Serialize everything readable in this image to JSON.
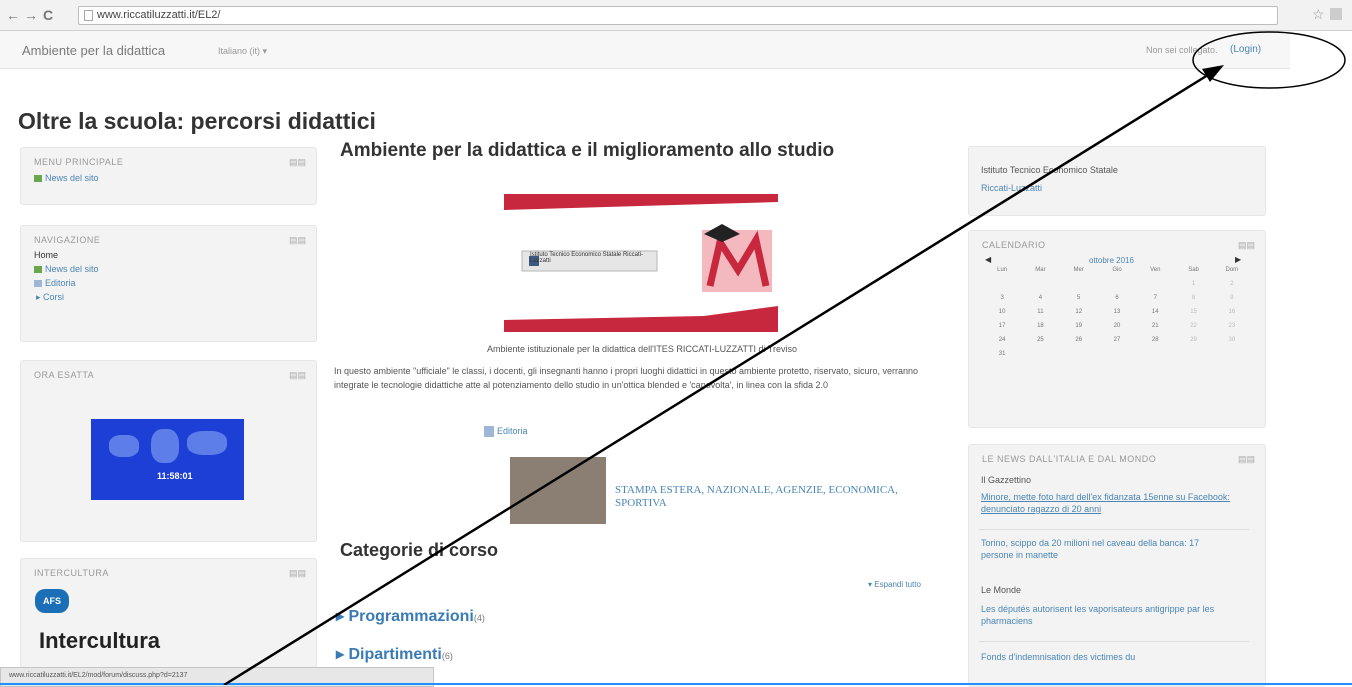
{
  "browser": {
    "back_icon": "back-arrow-icon",
    "forward_icon": "forward-arrow-icon",
    "reload_icon": "reload-icon",
    "url": "www.riccatiluzzatti.it/EL2/"
  },
  "header": {
    "site_name": "Ambiente per la didattica",
    "language": "Italiano (it) ▾",
    "login_message": "Non sei collegato.",
    "login_link": "(Login)"
  },
  "page_title": "Oltre la scuola: percorsi didattici",
  "left_blocks": {
    "menu": {
      "title": "MENU PRINCIPALE",
      "items": [
        "News del sito"
      ]
    },
    "nav": {
      "title": "NAVIGAZIONE",
      "items": [
        "Home",
        "News del sito",
        "Editoria",
        "Corsi"
      ]
    },
    "time": {
      "title": "ORA ESATTA",
      "clock": "11:58:01"
    },
    "intercultura": {
      "title": "INTERCULTURA",
      "logo_badge": "AFS",
      "logo_text": "Intercultura"
    }
  },
  "main": {
    "heading": "Ambiente per la didattica e il miglioramento allo studio",
    "banner_label": "Istituto Tecnico Economico Statale Riccati-Luzzatti",
    "caption": "Ambiente istituzionale per la didattica dell'ITES RICCATI-LUZZATTI di Treviso",
    "intro": "In questo ambiente \"ufficiale\" le classi, i docenti, gli insegnanti hanno i propri luoghi didattici in questo ambiente protetto, riservato, sicuro, verranno integrate le tecnologie didattiche atte al potenziamento dello studio in un'ottica blended e 'capovolta', in linea con la sfida 2.0",
    "editoria_link": "Editoria",
    "press_link": "STAMPA ESTERA, NAZIONALE, AGENZIE, ECONOMICA, SPORTIVA",
    "categories_title": "Categorie di corso",
    "expand_all": "▾ Espandi tutto",
    "categories": [
      {
        "name": "Programmazioni",
        "count": "(4)"
      },
      {
        "name": "Dipartimenti",
        "count": "(6)"
      }
    ]
  },
  "right_blocks": {
    "school": {
      "name": "Istituto Tecnico Economico Statale",
      "link": "Riccati-Luzzatti"
    },
    "calendar": {
      "title": "CALENDARIO",
      "month": "ottobre 2016",
      "weekdays": [
        "Lun",
        "Mar",
        "Mer",
        "Gio",
        "Ven",
        "Sab",
        "Dom"
      ],
      "weeks": [
        [
          "",
          "",
          "",
          "",
          "",
          "1",
          "2"
        ],
        [
          "3",
          "4",
          "5",
          "6",
          "7",
          "8",
          "9"
        ],
        [
          "10",
          "11",
          "12",
          "13",
          "14",
          "15",
          "16"
        ],
        [
          "17",
          "18",
          "19",
          "20",
          "21",
          "22",
          "23"
        ],
        [
          "24",
          "25",
          "26",
          "27",
          "28",
          "29",
          "30"
        ],
        [
          "31",
          "",
          "",
          "",
          "",
          "",
          ""
        ]
      ]
    },
    "news": {
      "title": "LE NEWS DALL'ITALIA E DAL MONDO",
      "source1": "Il Gazzettino",
      "item1": "Minore, mette foto hard dell'ex fidanzata 15enne su Facebook: denunciato ragazzo di 20 anni",
      "item2": "Torino, scippo da 20 milioni nel caveau della banca: 17 persone in manette",
      "source2": "Le Monde",
      "item3": "Les députés autorisent les vaporisateurs antigrippe par les pharmaciens",
      "item4": "Fonds d'indemnisation des victimes du"
    }
  },
  "status_url": "www.riccatiluzzatti.it/EL2/mod/forum/discuss.php?d=2137"
}
